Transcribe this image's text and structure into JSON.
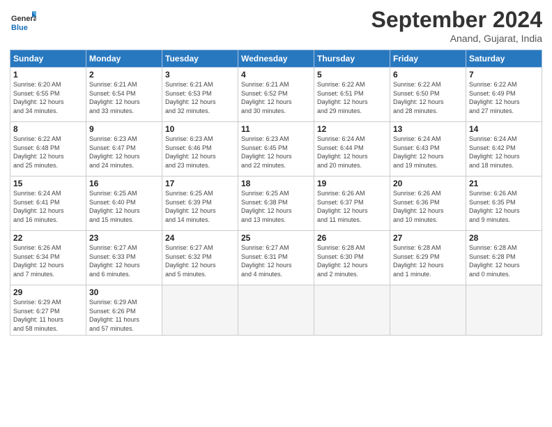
{
  "header": {
    "logo_general": "General",
    "logo_blue": "Blue",
    "month_title": "September 2024",
    "location": "Anand, Gujarat, India"
  },
  "days_of_week": [
    "Sunday",
    "Monday",
    "Tuesday",
    "Wednesday",
    "Thursday",
    "Friday",
    "Saturday"
  ],
  "weeks": [
    [
      {
        "day": "1",
        "info": "Sunrise: 6:20 AM\nSunset: 6:55 PM\nDaylight: 12 hours\nand 34 minutes."
      },
      {
        "day": "2",
        "info": "Sunrise: 6:21 AM\nSunset: 6:54 PM\nDaylight: 12 hours\nand 33 minutes."
      },
      {
        "day": "3",
        "info": "Sunrise: 6:21 AM\nSunset: 6:53 PM\nDaylight: 12 hours\nand 32 minutes."
      },
      {
        "day": "4",
        "info": "Sunrise: 6:21 AM\nSunset: 6:52 PM\nDaylight: 12 hours\nand 30 minutes."
      },
      {
        "day": "5",
        "info": "Sunrise: 6:22 AM\nSunset: 6:51 PM\nDaylight: 12 hours\nand 29 minutes."
      },
      {
        "day": "6",
        "info": "Sunrise: 6:22 AM\nSunset: 6:50 PM\nDaylight: 12 hours\nand 28 minutes."
      },
      {
        "day": "7",
        "info": "Sunrise: 6:22 AM\nSunset: 6:49 PM\nDaylight: 12 hours\nand 27 minutes."
      }
    ],
    [
      {
        "day": "8",
        "info": "Sunrise: 6:22 AM\nSunset: 6:48 PM\nDaylight: 12 hours\nand 25 minutes."
      },
      {
        "day": "9",
        "info": "Sunrise: 6:23 AM\nSunset: 6:47 PM\nDaylight: 12 hours\nand 24 minutes."
      },
      {
        "day": "10",
        "info": "Sunrise: 6:23 AM\nSunset: 6:46 PM\nDaylight: 12 hours\nand 23 minutes."
      },
      {
        "day": "11",
        "info": "Sunrise: 6:23 AM\nSunset: 6:45 PM\nDaylight: 12 hours\nand 22 minutes."
      },
      {
        "day": "12",
        "info": "Sunrise: 6:24 AM\nSunset: 6:44 PM\nDaylight: 12 hours\nand 20 minutes."
      },
      {
        "day": "13",
        "info": "Sunrise: 6:24 AM\nSunset: 6:43 PM\nDaylight: 12 hours\nand 19 minutes."
      },
      {
        "day": "14",
        "info": "Sunrise: 6:24 AM\nSunset: 6:42 PM\nDaylight: 12 hours\nand 18 minutes."
      }
    ],
    [
      {
        "day": "15",
        "info": "Sunrise: 6:24 AM\nSunset: 6:41 PM\nDaylight: 12 hours\nand 16 minutes."
      },
      {
        "day": "16",
        "info": "Sunrise: 6:25 AM\nSunset: 6:40 PM\nDaylight: 12 hours\nand 15 minutes."
      },
      {
        "day": "17",
        "info": "Sunrise: 6:25 AM\nSunset: 6:39 PM\nDaylight: 12 hours\nand 14 minutes."
      },
      {
        "day": "18",
        "info": "Sunrise: 6:25 AM\nSunset: 6:38 PM\nDaylight: 12 hours\nand 13 minutes."
      },
      {
        "day": "19",
        "info": "Sunrise: 6:26 AM\nSunset: 6:37 PM\nDaylight: 12 hours\nand 11 minutes."
      },
      {
        "day": "20",
        "info": "Sunrise: 6:26 AM\nSunset: 6:36 PM\nDaylight: 12 hours\nand 10 minutes."
      },
      {
        "day": "21",
        "info": "Sunrise: 6:26 AM\nSunset: 6:35 PM\nDaylight: 12 hours\nand 9 minutes."
      }
    ],
    [
      {
        "day": "22",
        "info": "Sunrise: 6:26 AM\nSunset: 6:34 PM\nDaylight: 12 hours\nand 7 minutes."
      },
      {
        "day": "23",
        "info": "Sunrise: 6:27 AM\nSunset: 6:33 PM\nDaylight: 12 hours\nand 6 minutes."
      },
      {
        "day": "24",
        "info": "Sunrise: 6:27 AM\nSunset: 6:32 PM\nDaylight: 12 hours\nand 5 minutes."
      },
      {
        "day": "25",
        "info": "Sunrise: 6:27 AM\nSunset: 6:31 PM\nDaylight: 12 hours\nand 4 minutes."
      },
      {
        "day": "26",
        "info": "Sunrise: 6:28 AM\nSunset: 6:30 PM\nDaylight: 12 hours\nand 2 minutes."
      },
      {
        "day": "27",
        "info": "Sunrise: 6:28 AM\nSunset: 6:29 PM\nDaylight: 12 hours\nand 1 minute."
      },
      {
        "day": "28",
        "info": "Sunrise: 6:28 AM\nSunset: 6:28 PM\nDaylight: 12 hours\nand 0 minutes."
      }
    ],
    [
      {
        "day": "29",
        "info": "Sunrise: 6:29 AM\nSunset: 6:27 PM\nDaylight: 11 hours\nand 58 minutes."
      },
      {
        "day": "30",
        "info": "Sunrise: 6:29 AM\nSunset: 6:26 PM\nDaylight: 11 hours\nand 57 minutes."
      },
      {
        "day": "",
        "info": ""
      },
      {
        "day": "",
        "info": ""
      },
      {
        "day": "",
        "info": ""
      },
      {
        "day": "",
        "info": ""
      },
      {
        "day": "",
        "info": ""
      }
    ]
  ]
}
